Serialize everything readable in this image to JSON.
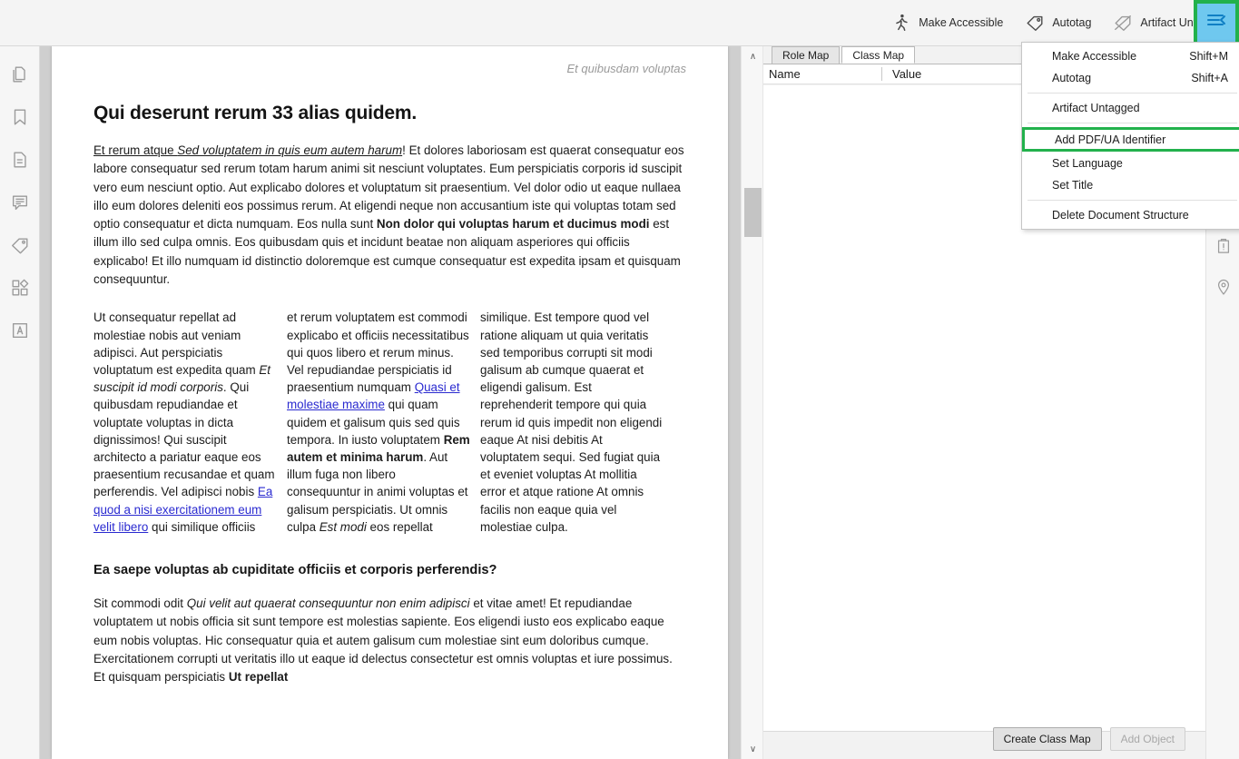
{
  "toolbar": {
    "items": [
      {
        "label": "Make Accessible",
        "icon": "accessibility-person-icon"
      },
      {
        "label": "Autotag",
        "icon": "tag-icon"
      },
      {
        "label": "Artifact Untagged",
        "icon": "tag-slash-icon"
      }
    ],
    "hamburger_icon": "menu-collapse-icon",
    "highlight_color": "#22b14c",
    "hamburger_bg": "#6fc8ef"
  },
  "menu": {
    "items": [
      {
        "label": "Make Accessible",
        "shortcut": "Shift+M",
        "highlight": false,
        "sep_after": false
      },
      {
        "label": "Autotag",
        "shortcut": "Shift+A",
        "highlight": false,
        "sep_after": true
      },
      {
        "label": "Artifact Untagged",
        "shortcut": "",
        "highlight": false,
        "sep_after": true
      },
      {
        "label": "Add PDF/UA Identifier",
        "shortcut": "",
        "highlight": true,
        "sep_after": false
      },
      {
        "label": "Set Language",
        "shortcut": "",
        "highlight": false,
        "sep_after": false
      },
      {
        "label": "Set Title",
        "shortcut": "",
        "highlight": false,
        "sep_after": true
      },
      {
        "label": "Delete Document Structure",
        "shortcut": "",
        "highlight": false,
        "sep_after": false
      }
    ]
  },
  "left_rail": {
    "items": [
      {
        "name": "page-thumbnails-icon"
      },
      {
        "name": "bookmarks-icon"
      },
      {
        "name": "document-icon"
      },
      {
        "name": "comments-icon"
      },
      {
        "name": "tags-icon"
      },
      {
        "name": "layers-icon"
      },
      {
        "name": "accessibility-letter-icon"
      }
    ]
  },
  "right_rail": {
    "items": [
      {
        "name": "clipboard-alert-icon"
      },
      {
        "name": "location-pin-icon"
      }
    ]
  },
  "panel": {
    "tabs": [
      {
        "label": "Role Map",
        "active": false
      },
      {
        "label": "Class Map",
        "active": true
      }
    ],
    "columns": [
      "Name",
      "Value"
    ],
    "rows": [],
    "buttons": [
      {
        "label": "Create Class Map",
        "disabled": false
      },
      {
        "label": "Add Object",
        "disabled": true
      }
    ]
  },
  "document": {
    "running_head": "Et quibusdam voluptas",
    "heading1": "Qui deserunt rerum 33 alias quidem.",
    "para1": {
      "lead_underline_plain": "Et rerum atque ",
      "lead_underline_italic": "Sed voluptatem in quis eum autem harum",
      "after_lead": "! Et dolores laboriosam est quaerat consequatur eos labore consequatur sed rerum totam harum animi sit nesciunt voluptates. Eum perspiciatis corporis id suscipit vero eum nesciunt optio. Aut explicabo dolores et voluptatum sit praesentium. Vel dolor odio ut eaque nullaea illo eum dolores deleniti eos possimus rerum. At eligendi neque non accusantium iste qui voluptas totam sed optio consequatur et dicta numquam. Eos nulla sunt ",
      "bold_part": "Non dolor qui voluptas harum et ducimus modi",
      "tail": " est illum illo sed culpa omnis. Eos quibusdam quis et incidunt beatae non aliquam asperiores qui officiis explicabo! Et illo numquam id distinctio doloremque est cumque consequatur est expedita ipsam et quisquam consequuntur."
    },
    "col1": {
      "p1": "Ut consequatur repellat ad molestiae nobis aut veniam adipisci. Aut perspiciatis voluptatum est expedita quam ",
      "italic": "Et suscipit id modi corporis",
      "p2": ". Qui quibusdam repudiandae et voluptate voluptas in dicta dignissimos! Qui suscipit architecto a pariatur eaque eos praesentium recusandae et quam perferendis. Vel adipisci nobis ",
      "link": "Ea quod a nisi exercitationem eum velit libero",
      "p3": " qui similique officiis"
    },
    "col2": {
      "p1": "et rerum voluptatem est commodi explicabo et officiis necessitatibus qui quos libero et rerum minus. Vel repudiandae perspiciatis id praesentium numquam ",
      "link": "Quasi et molestiae maxime",
      "p2": " qui quam quidem et galisum quis sed quis tempora. In iusto voluptatem ",
      "bold": "Rem autem et minima harum",
      "p3": ". Aut illum fuga non libero consequuntur in animi voluptas et galisum perspiciatis. Ut omnis culpa ",
      "italic": "Est modi",
      "p4": " eos repellat"
    },
    "col3": {
      "text": "similique. Est tempore quod vel ratione aliquam ut quia veritatis sed temporibus corrupti sit modi galisum ab cumque quaerat et eligendi galisum. Est reprehenderit tempore qui quia rerum id quis impedit non eligendi eaque At nisi debitis At voluptatem sequi. Sed fugiat quia et eveniet voluptas At mollitia error et atque ratione At omnis facilis non eaque quia vel molestiae culpa."
    },
    "heading2": "Ea saepe voluptas ab cupiditate officiis et corporis perferendis?",
    "para2": {
      "lead": "Sit commodi odit ",
      "italic": "Qui velit aut quaerat consequuntur non enim adipisci",
      "mid": " et vitae amet! Et repudiandae voluptatem ut nobis officia sit sunt tempore est molestias sapiente. Eos eligendi iusto eos explicabo eaque eum nobis voluptas. Hic consequatur quia et autem galisum cum molestiae sint eum doloribus cumque. Exercitationem corrupti ut veritatis illo ut eaque id delectus consectetur est omnis voluptas et iure possimus. Et quisquam perspiciatis ",
      "bold": "Ut repellat"
    }
  },
  "scrollbars": {
    "doc_up_arrow": "∧",
    "doc_down_arrow": "∨"
  }
}
